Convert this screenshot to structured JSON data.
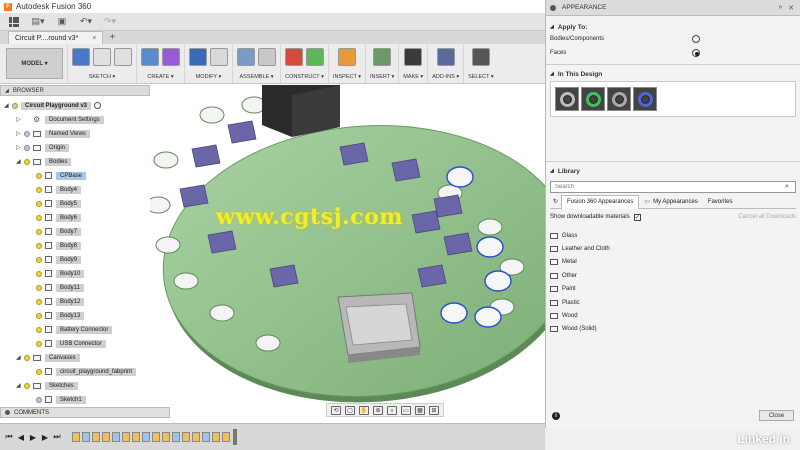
{
  "window": {
    "title": "Autodesk Fusion 360",
    "app_icon": "F"
  },
  "document_tab": {
    "label": "Circuit P....round v3*",
    "close": "×",
    "add": "+"
  },
  "toolbar": {
    "workspace": "MODEL ▾",
    "groups": [
      {
        "label": "SKETCH ▾",
        "icons": [
          "#4a78c8",
          "#e0e0e0",
          "#e0e0e0"
        ]
      },
      {
        "label": "CREATE ▾",
        "icons": [
          "#5a8ad0",
          "#9a5ad8"
        ]
      },
      {
        "label": "MODIFY ▾",
        "icons": [
          "#3a6ab8",
          "#d9d9d9"
        ]
      },
      {
        "label": "ASSEMBLE ▾",
        "icons": [
          "#7a9ac8",
          "#c8c8c8"
        ]
      },
      {
        "label": "CONSTRUCT ▾",
        "icons": [
          "#d84a3a",
          "#5ab858"
        ]
      },
      {
        "label": "INSPECT ▾",
        "icons": [
          "#e89a3a"
        ]
      },
      {
        "label": "INSERT ▾",
        "icons": [
          "#6a9a6a"
        ]
      },
      {
        "label": "MAKE ▾",
        "icons": [
          "#3a3a3a"
        ]
      },
      {
        "label": "ADD-INS ▾",
        "icons": [
          "#5a6a9a"
        ]
      },
      {
        "label": "SELECT ▾",
        "icons": [
          "#555555"
        ]
      }
    ]
  },
  "browser": {
    "header": "BROWSER",
    "items": [
      {
        "label": "Circuit Playground v3",
        "indent": 0,
        "arrow": "◢",
        "kind": "root"
      },
      {
        "label": "Document Settings",
        "indent": 1,
        "arrow": "▷",
        "kind": "gear"
      },
      {
        "label": "Named Views",
        "indent": 1,
        "arrow": "▷",
        "kind": "folder"
      },
      {
        "label": "Origin",
        "indent": 1,
        "arrow": "▷",
        "kind": "folder-off"
      },
      {
        "label": "Bodies",
        "indent": 1,
        "arrow": "◢",
        "kind": "folder-on"
      },
      {
        "label": "CPBase",
        "indent": 2,
        "arrow": "",
        "kind": "body-sel"
      },
      {
        "label": "Body4",
        "indent": 2,
        "arrow": "",
        "kind": "body"
      },
      {
        "label": "Body5",
        "indent": 2,
        "arrow": "",
        "kind": "body"
      },
      {
        "label": "Body6",
        "indent": 2,
        "arrow": "",
        "kind": "body"
      },
      {
        "label": "Body7",
        "indent": 2,
        "arrow": "",
        "kind": "body"
      },
      {
        "label": "Body8",
        "indent": 2,
        "arrow": "",
        "kind": "body"
      },
      {
        "label": "Body9",
        "indent": 2,
        "arrow": "",
        "kind": "body"
      },
      {
        "label": "Body10",
        "indent": 2,
        "arrow": "",
        "kind": "body"
      },
      {
        "label": "Body11",
        "indent": 2,
        "arrow": "",
        "kind": "body"
      },
      {
        "label": "Body12",
        "indent": 2,
        "arrow": "",
        "kind": "body"
      },
      {
        "label": "Body13",
        "indent": 2,
        "arrow": "",
        "kind": "body"
      },
      {
        "label": "Battery Connector",
        "indent": 2,
        "arrow": "",
        "kind": "body"
      },
      {
        "label": "USB Connector",
        "indent": 2,
        "arrow": "",
        "kind": "body"
      },
      {
        "label": "Canvases",
        "indent": 1,
        "arrow": "◢",
        "kind": "folder-on"
      },
      {
        "label": "circuit_playground_fabprint",
        "indent": 2,
        "arrow": "",
        "kind": "body"
      },
      {
        "label": "Sketches",
        "indent": 1,
        "arrow": "◢",
        "kind": "folder-on"
      },
      {
        "label": "Sketch1",
        "indent": 2,
        "arrow": "",
        "kind": "body-off"
      }
    ]
  },
  "comments": {
    "label": "COMMENTS"
  },
  "viewport": {
    "watermark": "www.cgtsj.com"
  },
  "appearance": {
    "title": "APPEARANCE",
    "apply_to": {
      "title": "Apply To:",
      "options": [
        {
          "label": "Bodies/Components",
          "selected": false
        },
        {
          "label": "Faces",
          "selected": true
        }
      ]
    },
    "in_design": {
      "title": "In This Design",
      "swatches": [
        "#bbbbbb",
        "#3fc25a",
        "#a8a8a8",
        "#4a68e0"
      ]
    },
    "library": {
      "title": "Library",
      "search_placeholder": "Search",
      "tabs": [
        "Fusion 360 Appearances",
        "My Appearances",
        "Favorites"
      ],
      "show_downloadable": "Show downloadable materials",
      "cancel_downloads": "Cancel all Downloads",
      "categories": [
        "Glass",
        "Leather and Cloth",
        "Metal",
        "Other",
        "Paint",
        "Plastic",
        "Wood",
        "Wood (Solid)"
      ]
    },
    "close_label": "Close",
    "info": "i"
  },
  "branding": {
    "linkedin": "Linked in"
  },
  "colors": {
    "board": "#8fc08a",
    "chip": "#6b66a8",
    "selection": "#2a4bd0"
  }
}
